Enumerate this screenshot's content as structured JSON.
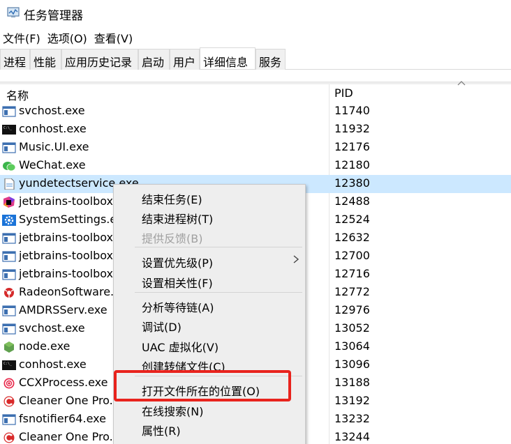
{
  "window": {
    "title": "任务管理器"
  },
  "menu": [
    "文件(F)",
    "选项(O)",
    "查看(V)"
  ],
  "tabs": [
    "进程",
    "性能",
    "应用历史记录",
    "启动",
    "用户",
    "详细信息",
    "服务"
  ],
  "active_tab": "详细信息",
  "table": {
    "headers": {
      "name": "名称",
      "pid": "PID"
    },
    "rows": [
      {
        "name": "svchost.exe",
        "pid": "11740",
        "icon": "window-icon"
      },
      {
        "name": "conhost.exe",
        "pid": "11932",
        "icon": "console-icon"
      },
      {
        "name": "Music.UI.exe",
        "pid": "12176",
        "icon": "window-icon"
      },
      {
        "name": "WeChat.exe",
        "pid": "12180",
        "icon": "wechat-icon"
      },
      {
        "name": "yundetectservice.exe",
        "pid": "12380",
        "icon": "document-icon",
        "selected": true
      },
      {
        "name": "jetbrains-toolbox",
        "pid": "12488",
        "icon": "jetbrains-icon"
      },
      {
        "name": "SystemSettings.e",
        "pid": "12524",
        "icon": "gear-icon"
      },
      {
        "name": "jetbrains-toolbox",
        "pid": "12632",
        "icon": "window-icon"
      },
      {
        "name": "jetbrains-toolbox",
        "pid": "12700",
        "icon": "window-icon"
      },
      {
        "name": "jetbrains-toolbox",
        "pid": "12716",
        "icon": "window-icon"
      },
      {
        "name": "RadeonSoftware.",
        "pid": "12772",
        "icon": "radeon-icon"
      },
      {
        "name": "AMDRSServ.exe",
        "pid": "12976",
        "icon": "window-icon"
      },
      {
        "name": "svchost.exe",
        "pid": "13052",
        "icon": "window-icon"
      },
      {
        "name": "node.exe",
        "pid": "13064",
        "icon": "nodejs-icon"
      },
      {
        "name": "conhost.exe",
        "pid": "13096",
        "icon": "console-icon"
      },
      {
        "name": "CCXProcess.exe",
        "pid": "13188",
        "icon": "creative-cloud-icon"
      },
      {
        "name": "Cleaner One Pro.",
        "pid": "13192",
        "icon": "cleaner-icon"
      },
      {
        "name": "fsnotifier64.exe",
        "pid": "13232",
        "icon": "window-icon"
      },
      {
        "name": "Cleaner One Pro.",
        "pid": "13244",
        "icon": "cleaner-icon"
      }
    ]
  },
  "context_menu": {
    "items": [
      {
        "label": "结束任务(E)"
      },
      {
        "label": "结束进程树(T)"
      },
      {
        "label": "提供反馈(B)",
        "disabled": true
      },
      {
        "label": "设置优先级(P)",
        "submenu": true
      },
      {
        "label": "设置相关性(F)"
      },
      {
        "label": "分析等待链(A)"
      },
      {
        "label": "调试(D)"
      },
      {
        "label": "UAC 虚拟化(V)"
      },
      {
        "label": "创建转储文件(C)"
      },
      {
        "label": "打开文件所在的位置(O)",
        "highlighted": true
      },
      {
        "label": "在线搜索(N)"
      },
      {
        "label": "属性(R)"
      }
    ]
  },
  "colors": {
    "selection": "#cce8ff",
    "highlight_box": "#e8231d",
    "menu_bg": "#eeeeee"
  }
}
